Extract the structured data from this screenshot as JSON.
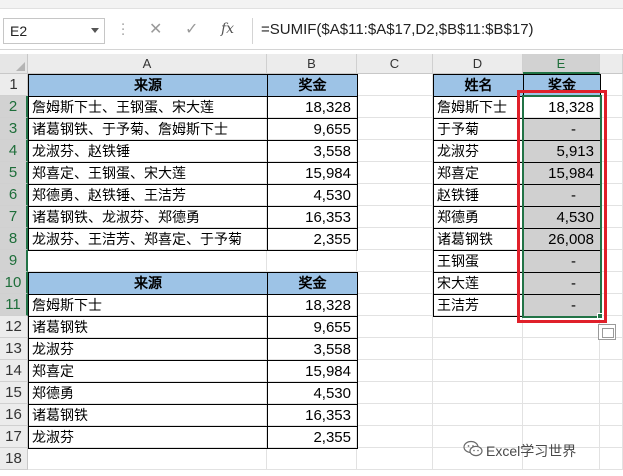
{
  "formula_bar": {
    "name_box": "E2",
    "cancel_icon": "✕",
    "enter_icon": "✓",
    "function_icon": "fx",
    "formula": "=SUMIF($A$11:$A$17,D2,$B$11:$B$17)"
  },
  "columns": [
    "A",
    "B",
    "C",
    "D",
    "E"
  ],
  "rows": [
    "1",
    "2",
    "3",
    "4",
    "5",
    "6",
    "7",
    "8",
    "9",
    "10",
    "11",
    "12",
    "13",
    "14",
    "15",
    "16",
    "17",
    "18"
  ],
  "table1": {
    "header": [
      "来源",
      "奖金"
    ],
    "rows": [
      [
        "詹姆斯下士、王钢蛋、宋大莲",
        "18,328"
      ],
      [
        "诸葛钢铁、于予菊、詹姆斯下士",
        "9,655"
      ],
      [
        "龙淑芬、赵铁锤",
        "3,558"
      ],
      [
        "郑喜定、王钢蛋、宋大莲",
        "15,984"
      ],
      [
        "郑德勇、赵铁锤、王洁芳",
        "4,530"
      ],
      [
        "诸葛钢铁、龙淑芬、郑德勇",
        "16,353"
      ],
      [
        "龙淑芬、王洁芳、郑喜定、于予菊",
        "2,355"
      ]
    ]
  },
  "table2": {
    "header": [
      "来源",
      "奖金"
    ],
    "rows": [
      [
        "詹姆斯下士",
        "18,328"
      ],
      [
        "诸葛钢铁",
        "9,655"
      ],
      [
        "龙淑芬",
        "3,558"
      ],
      [
        "郑喜定",
        "15,984"
      ],
      [
        "郑德勇",
        "4,530"
      ],
      [
        "诸葛钢铁",
        "16,353"
      ],
      [
        "龙淑芬",
        "2,355"
      ]
    ]
  },
  "table3": {
    "header": [
      "姓名",
      "奖金"
    ],
    "rows": [
      [
        "詹姆斯下士",
        "18,328"
      ],
      [
        "于予菊",
        "-"
      ],
      [
        "龙淑芬",
        "5,913"
      ],
      [
        "郑喜定",
        "15,984"
      ],
      [
        "赵铁锤",
        "-"
      ],
      [
        "郑德勇",
        "4,530"
      ],
      [
        "诸葛钢铁",
        "26,008"
      ],
      [
        "王钢蛋",
        "-"
      ],
      [
        "宋大莲",
        "-"
      ],
      [
        "王洁芳",
        "-"
      ]
    ]
  },
  "watermark": "Excel学习世界",
  "colors": {
    "header_fill": "#9dc3e6",
    "selection_fill": "#d0d0d0",
    "selection_border": "#217346",
    "highlight_box": "#e0202a"
  }
}
